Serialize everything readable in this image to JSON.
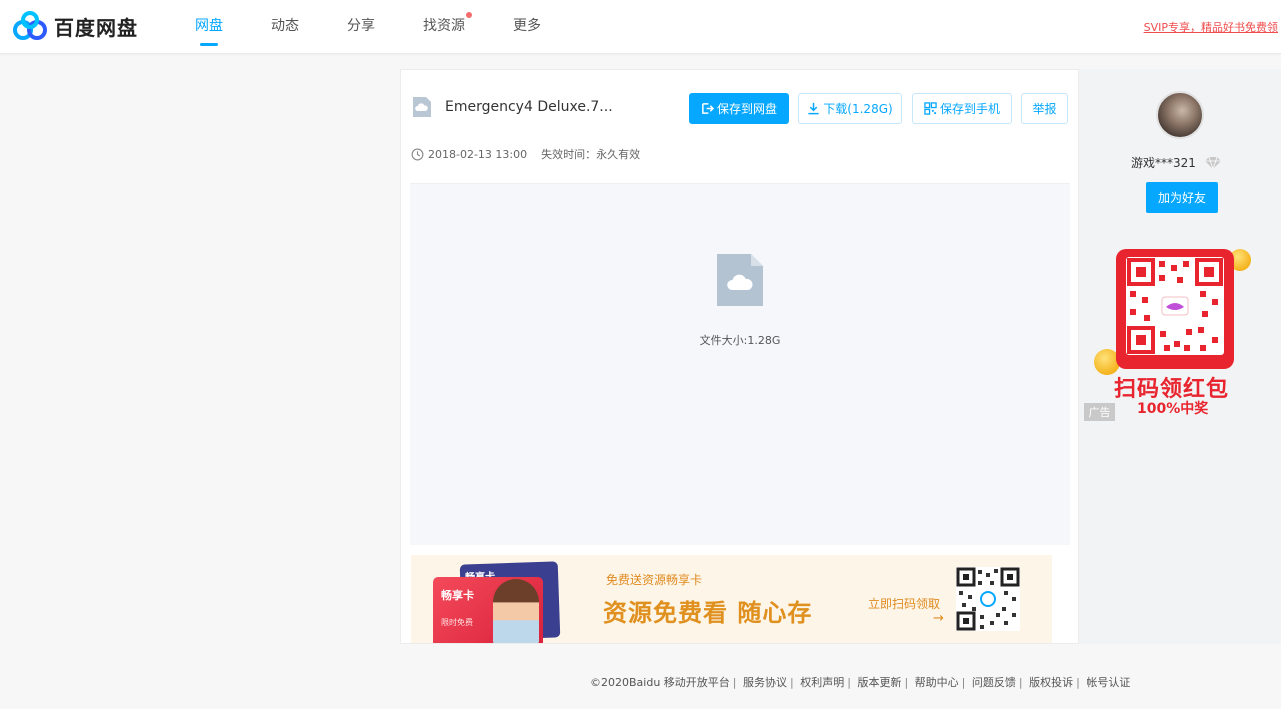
{
  "header": {
    "logo_text": "百度网盘",
    "nav": [
      {
        "label": "网盘",
        "active": true
      },
      {
        "label": "动态"
      },
      {
        "label": "分享"
      },
      {
        "label": "找资源",
        "dot": true
      },
      {
        "label": "更多"
      }
    ],
    "svip_link": "SVIP专享，精品好书免费领"
  },
  "file": {
    "name": "Emergency4 Deluxe.7...",
    "date": "2018-02-13 13:00",
    "expiry": "失效时间：永久有效",
    "size_text": "文件大小:1.28G"
  },
  "actions": {
    "save_label": "保存到网盘",
    "download_label": "下载(1.28G)",
    "phone_label": "保存到手机",
    "report_label": "举报"
  },
  "banner": {
    "card_title": "畅享卡",
    "card_back_title": "畅享卡",
    "card_sub": "限时免费",
    "small_text": "免费送资源畅享卡",
    "big_text": "资源免费看 随心存",
    "cta": "立即扫码领取",
    "arrow": "→"
  },
  "sidebar": {
    "username": "游戏***321",
    "add_friend": "加为好友",
    "ad_title": "扫码领红包",
    "ad_sub": "100%中奖",
    "ad_tag": "广告"
  },
  "footer": {
    "copyright": "©2020Baidu",
    "links": [
      "移动开放平台",
      "服务协议",
      "权利声明",
      "版本更新",
      "帮助中心",
      "问题反馈",
      "版权投诉",
      "帐号认证"
    ]
  },
  "colors": {
    "accent": "#06a7ff",
    "ad_red": "#e8242e",
    "banner_orange": "#e08a20"
  }
}
